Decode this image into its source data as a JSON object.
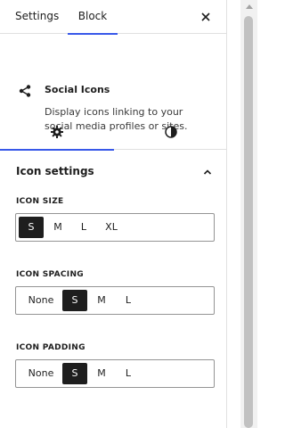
{
  "tabs": {
    "settings": "Settings",
    "block": "Block"
  },
  "close_icon": "close-icon",
  "block": {
    "icon": "share-icon",
    "title": "Social Icons",
    "description": "Display icons linking to your social media profiles or sites."
  },
  "subtabs": [
    {
      "icon": "gear-icon",
      "active": true
    },
    {
      "icon": "contrast-icon",
      "active": false
    }
  ],
  "section": {
    "title": "Icon settings",
    "expanded": true
  },
  "icon_size": {
    "label": "ICON SIZE",
    "options": [
      "S",
      "M",
      "L",
      "XL"
    ],
    "selected": "S"
  },
  "icon_spacing": {
    "label": "ICON SPACING",
    "options": [
      "None",
      "S",
      "M",
      "L"
    ],
    "selected": "S"
  },
  "icon_padding": {
    "label": "ICON PADDING",
    "options": [
      "None",
      "S",
      "M",
      "L"
    ],
    "selected": "S"
  },
  "colors": {
    "accent": "#3858e9",
    "selected_bg": "#1e1e1e",
    "border": "#949494"
  }
}
